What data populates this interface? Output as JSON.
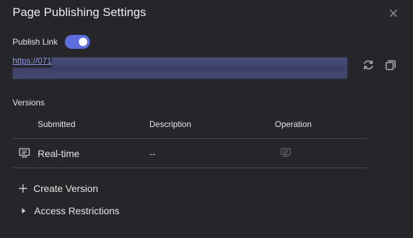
{
  "dialog": {
    "title": "Page Publishing Settings",
    "close_icon": "close-icon"
  },
  "publish": {
    "label": "Publish Link",
    "toggle_on": true,
    "accent_color": "#5d6ee0"
  },
  "link": {
    "visible_text": "https://071",
    "redacted": true,
    "refresh_icon": "refresh-icon",
    "copy_icon": "copy-icon"
  },
  "versions": {
    "section_label": "Versions",
    "columns": [
      "Submitted",
      "Description",
      "Operation"
    ],
    "rows": [
      {
        "submitted": "Real-time",
        "description": "--",
        "row_icon": "monitor-icon",
        "operation_icon": "monitor-icon"
      }
    ]
  },
  "actions": {
    "create_version_label": "Create Version",
    "create_icon": "plus-icon",
    "access_restrictions_label": "Access Restrictions",
    "access_icon": "caret-right-icon"
  }
}
